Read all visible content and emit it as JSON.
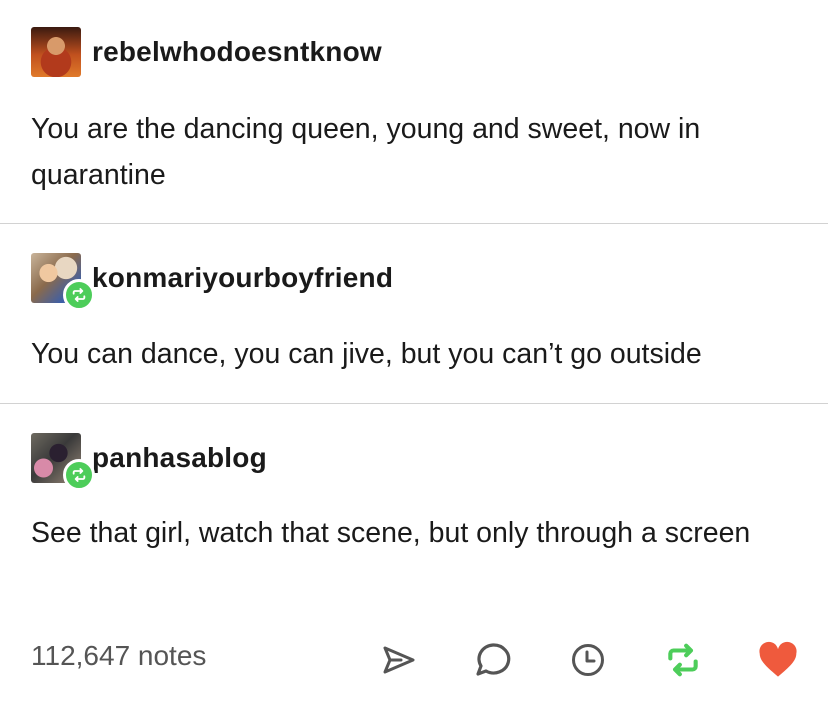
{
  "posts": [
    {
      "username": "rebelwhodoesntknow",
      "text": "You are the dancing queen, young and sweet, now in quarantine"
    },
    {
      "username": "konmariyourboyfriend",
      "text": "You can dance, you can jive, but you can’t go outside"
    },
    {
      "username": "panhasablog",
      "text": "See that girl, watch that scene, but only through a screen"
    }
  ],
  "footer": {
    "notes": "112,647 notes",
    "actions": [
      {
        "icon": "share-icon"
      },
      {
        "icon": "reply-icon"
      },
      {
        "icon": "clock-icon"
      },
      {
        "icon": "reblog-icon",
        "color": "#4dcd5a"
      },
      {
        "icon": "heart-icon",
        "color": "#ef5a3d"
      }
    ]
  },
  "colors": {
    "reblog_green": "#4dcd5a",
    "like_red": "#ef5a3d",
    "divider": "#d2d2d2"
  }
}
